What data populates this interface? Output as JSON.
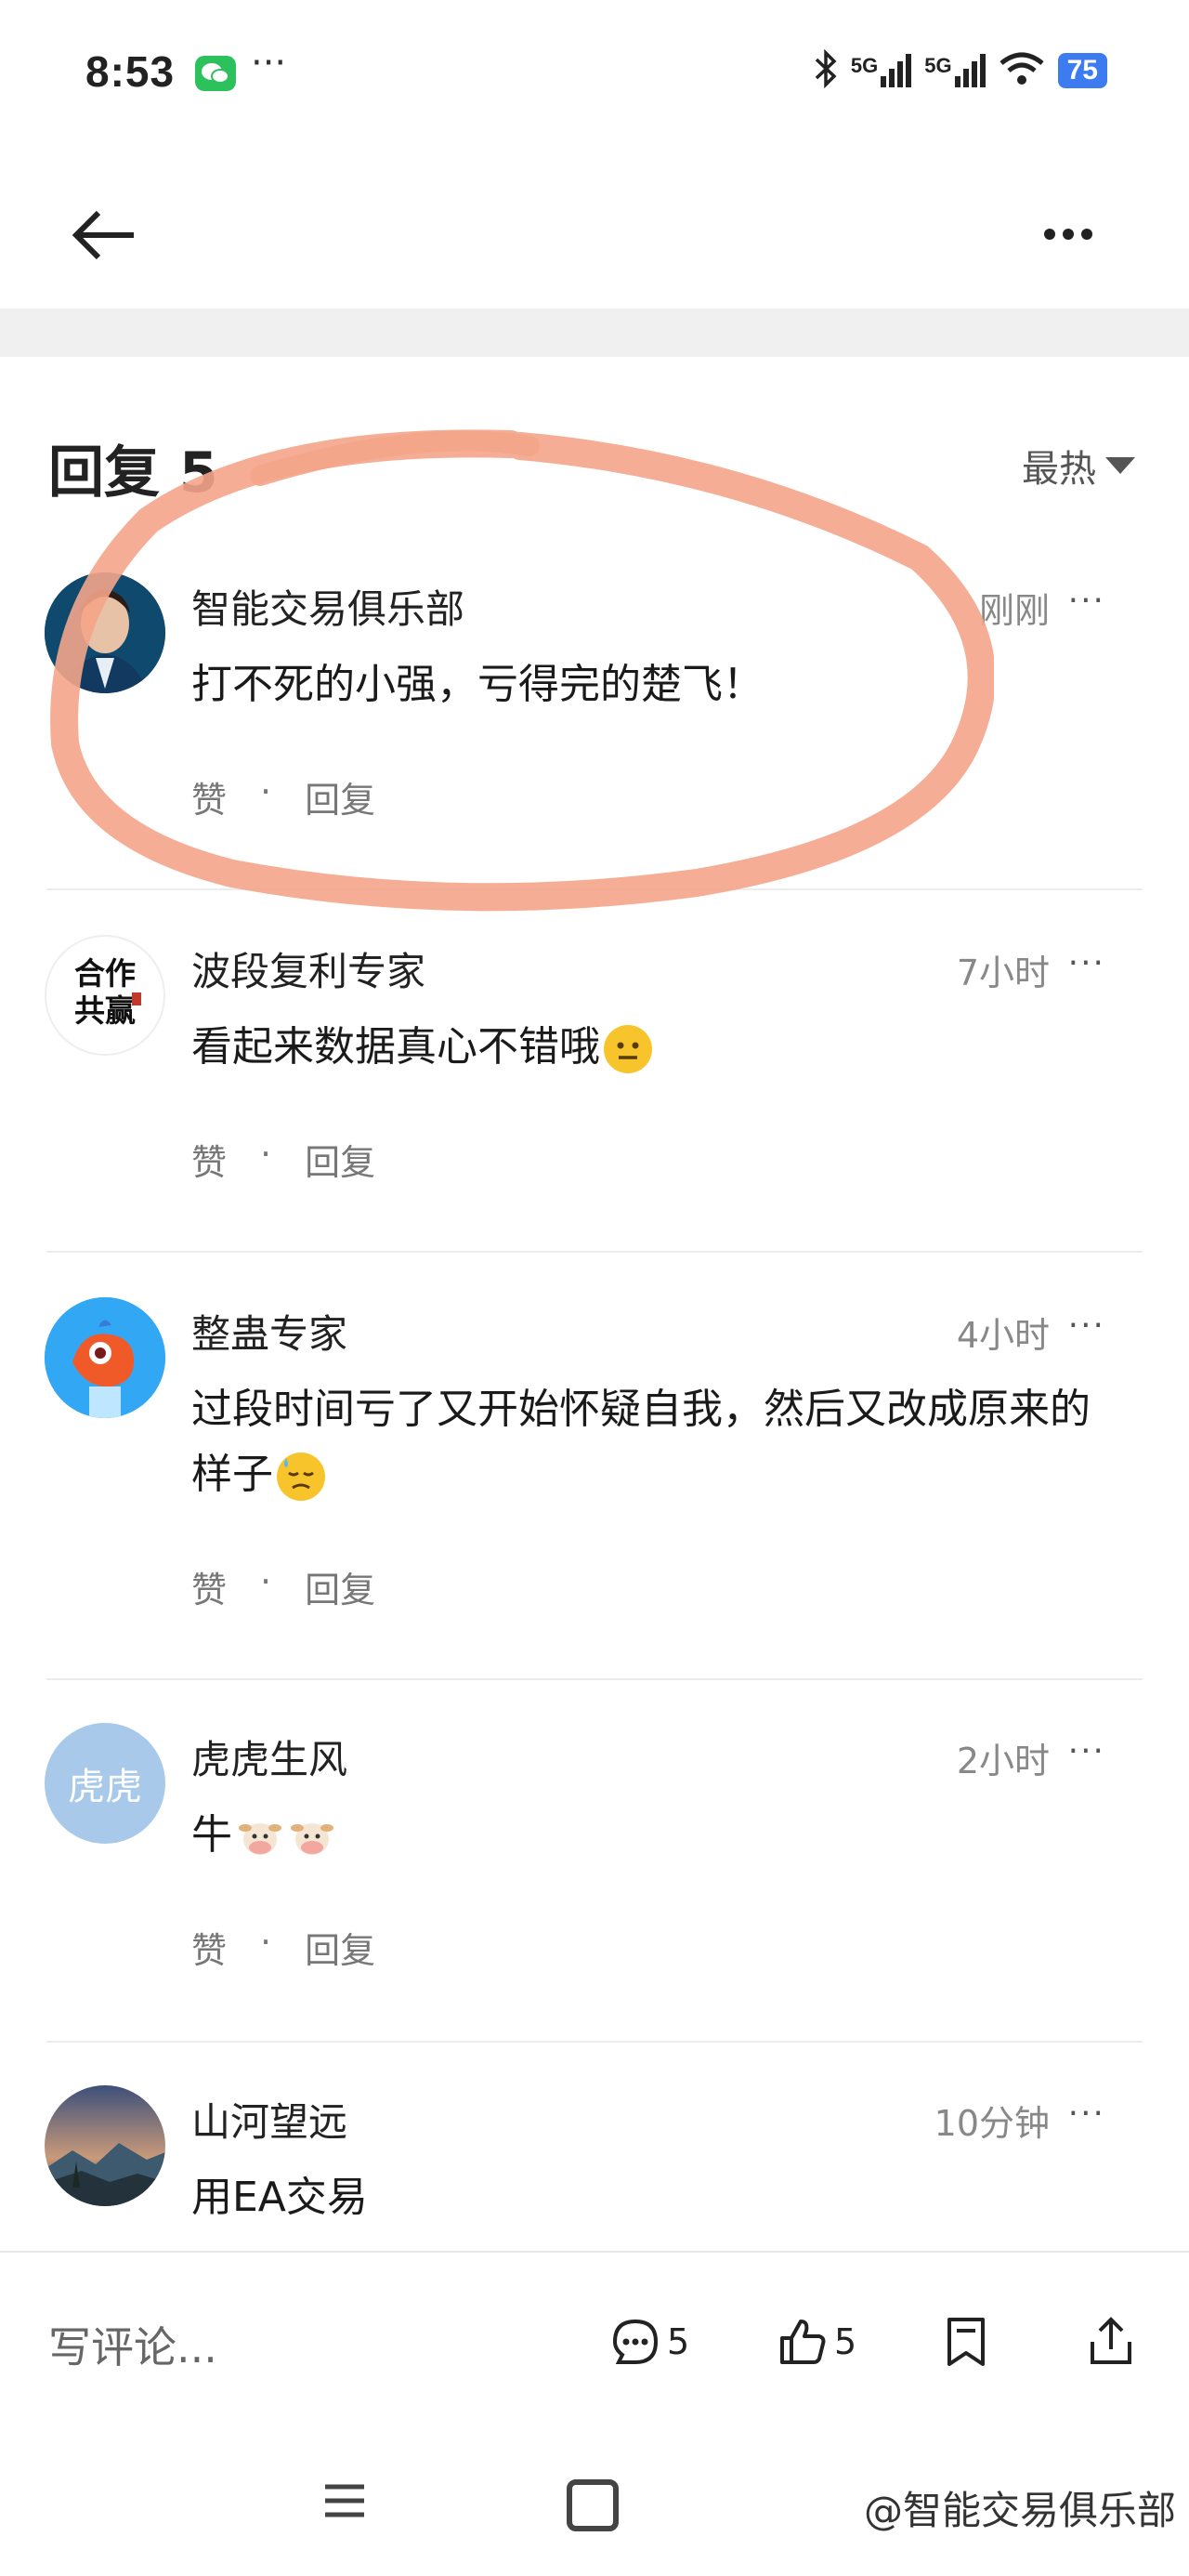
{
  "status_bar": {
    "time": "8:53",
    "dots": "···",
    "signal1": "5G",
    "signal2": "5G",
    "battery": "75"
  },
  "header": {
    "replies_title": "回复 5",
    "sort_label": "最热"
  },
  "comments": [
    {
      "author": "智能交易俱乐部",
      "time": "刚刚",
      "text": "打不死的小强，亏得完的楚飞！",
      "like": "赞",
      "reply": "回复"
    },
    {
      "author": "波段复利专家",
      "time": "7小时",
      "text": "看起来数据真心不错哦",
      "like": "赞",
      "reply": "回复",
      "avatar_text": "合作共赢"
    },
    {
      "author": "整蛊专家",
      "time": "4小时",
      "text": "过段时间亏了又开始怀疑自我，然后又改成原来的样子",
      "like": "赞",
      "reply": "回复"
    },
    {
      "author": "虎虎生风",
      "time": "2小时",
      "text": "牛",
      "like": "赞",
      "reply": "回复",
      "avatar_text": "虎虎"
    },
    {
      "author": "山河望远",
      "time": "10分钟",
      "text": "用EA交易"
    }
  ],
  "comment_more": "···",
  "action_dot": "·",
  "bottom_bar": {
    "placeholder": "写评论...",
    "comment_count": "5",
    "like_count": "5"
  },
  "watermark": "@智能交易俱乐部",
  "colors": {
    "highlight": "#f4a58a",
    "battery": "#3d7bf0",
    "wechat": "#2dc15e"
  }
}
